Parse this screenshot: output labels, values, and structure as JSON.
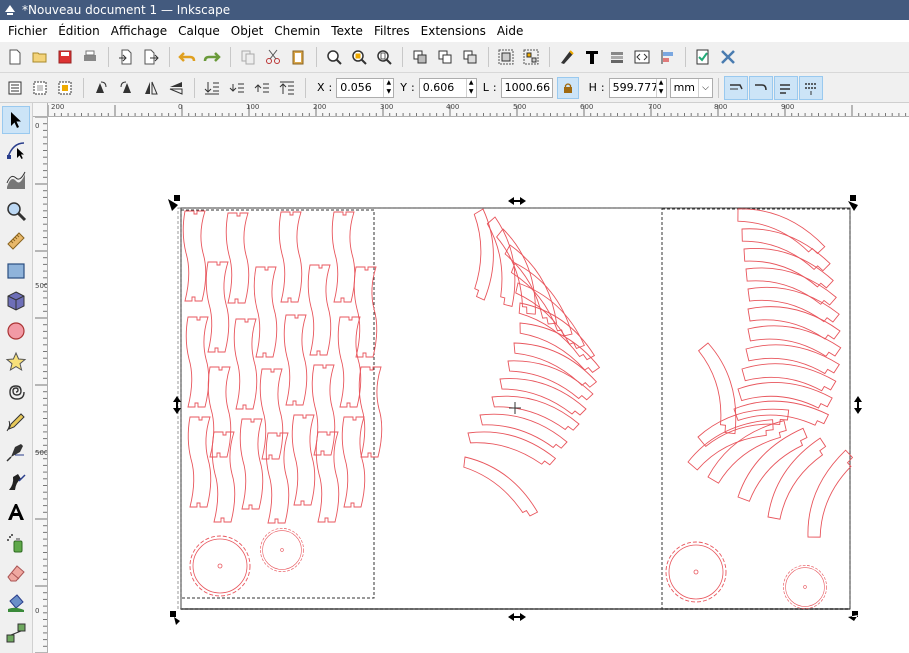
{
  "window": {
    "title": "*Nouveau document 1 — Inkscape"
  },
  "menu": [
    "Fichier",
    "Édition",
    "Affichage",
    "Calque",
    "Objet",
    "Chemin",
    "Texte",
    "Filtres",
    "Extensions",
    "Aide"
  ],
  "select_toolbar": {
    "x_label": "X",
    "x_value": "0.056",
    "y_label": "Y",
    "y_value": "0.606",
    "w_label": "L",
    "w_value": "1000.66",
    "h_label": "H",
    "h_value": "599.777",
    "unit": "mm"
  },
  "rulers": {
    "horizontal": [
      "200",
      "0",
      "100",
      "200",
      "300",
      "400",
      "500",
      "600",
      "700",
      "800",
      "900"
    ],
    "vertical": [
      "0",
      "500",
      "500",
      "0"
    ]
  },
  "colors": {
    "titlebar": "#435a7e",
    "pieces_stroke": "#e8555c",
    "selection_dash": "#333333",
    "toggle_active": "#cce4f7"
  },
  "tools": [
    "selector-tool",
    "node-tool",
    "tweak-tool",
    "zoom-tool",
    "measure-tool",
    "rect-tool",
    "3dbox-tool",
    "ellipse-tool",
    "star-tool",
    "spiral-tool",
    "pencil-tool",
    "pen-tool",
    "calligraphy-tool",
    "text-tool",
    "spray-tool",
    "eraser-tool",
    "paint-bucket-tool",
    "connector-tool"
  ]
}
